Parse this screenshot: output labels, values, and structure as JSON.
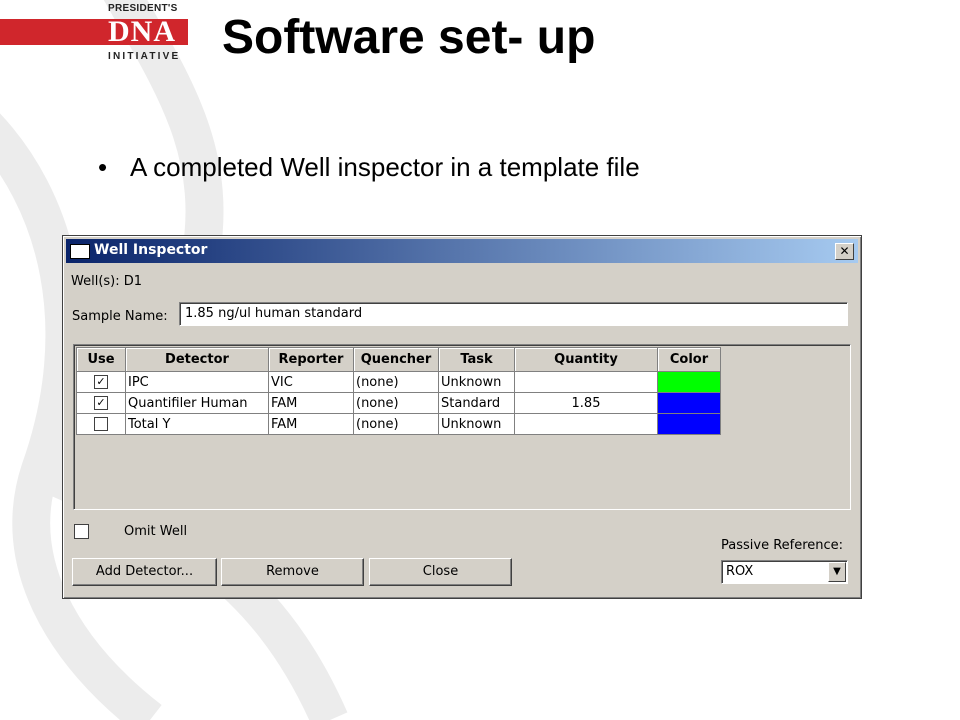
{
  "logo": {
    "top_line": "PRESIDENT'S",
    "middle": "DNA",
    "bottom_line": "INITIATIVE",
    "brand_color": "#d0262c"
  },
  "slide": {
    "title": "Software set- up",
    "bullet_marker": "•",
    "bullet_text": "A completed Well inspector in a template file"
  },
  "window": {
    "title": "Well Inspector",
    "close_glyph": "✕",
    "wells_label": "Well(s): D1",
    "sample_name_label": "Sample Name:",
    "sample_name_value": "1.85 ng/ul human standard",
    "columns": [
      "Use",
      "Detector",
      "Reporter",
      "Quencher",
      "Task",
      "Quantity",
      "Color"
    ],
    "rows": [
      {
        "use": "✓",
        "detector": "IPC",
        "reporter": "VIC",
        "quencher": "(none)",
        "task": "Unknown",
        "quantity": "",
        "color": "#00ff00"
      },
      {
        "use": "✓",
        "detector": "Quantifiler Human",
        "reporter": "FAM",
        "quencher": "(none)",
        "task": "Standard",
        "quantity": "1.85",
        "color": "#0000ff"
      },
      {
        "use": "",
        "detector": "Total Y",
        "reporter": "FAM",
        "quencher": "(none)",
        "task": "Unknown",
        "quantity": "",
        "color": "#0000ff"
      }
    ],
    "omit_well_label": "Omit Well",
    "buttons": {
      "add_detector": "Add Detector...",
      "remove": "Remove",
      "close": "Close"
    },
    "passive_reference_label": "Passive Reference:",
    "passive_reference_value": "ROX",
    "dropdown_glyph": "▼"
  }
}
